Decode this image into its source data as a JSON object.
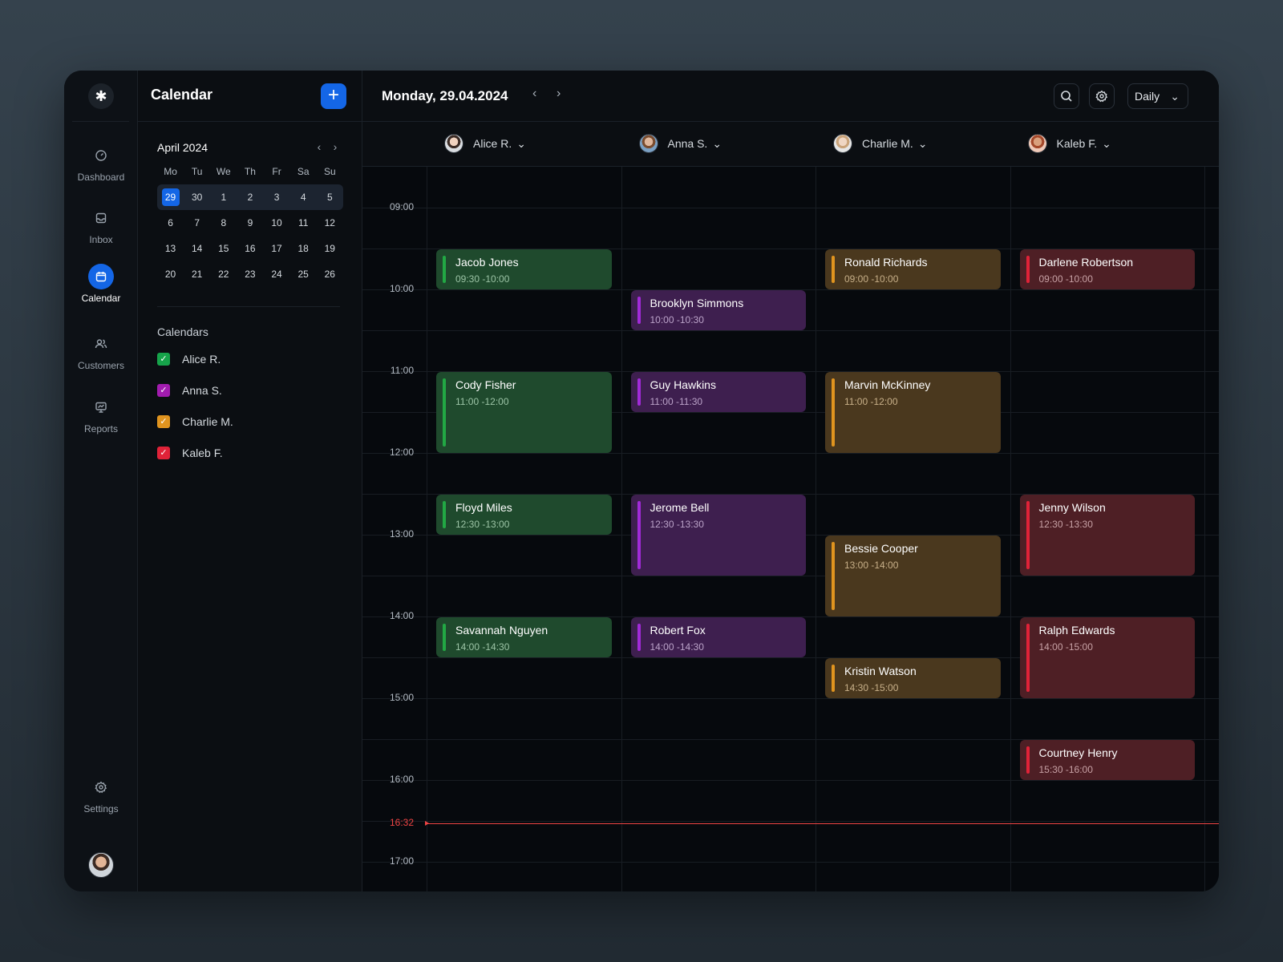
{
  "rail": {
    "items": [
      {
        "label": "Dashboard",
        "icon": "dashboard-icon"
      },
      {
        "label": "Inbox",
        "icon": "inbox-icon"
      },
      {
        "label": "Calendar",
        "icon": "calendar-icon",
        "active": true
      },
      {
        "label": "Customers",
        "icon": "customers-icon"
      },
      {
        "label": "Reports",
        "icon": "reports-icon"
      }
    ],
    "settings_label": "Settings"
  },
  "sidebar": {
    "title": "Calendar",
    "add_label": "+",
    "mini": {
      "month": "April 2024",
      "weekdays": [
        "Mo",
        "Tu",
        "We",
        "Th",
        "Fr",
        "Sa",
        "Su"
      ],
      "weeks": [
        [
          "29",
          "30",
          "1",
          "2",
          "3",
          "4",
          "5"
        ],
        [
          "6",
          "7",
          "8",
          "9",
          "10",
          "11",
          "12"
        ],
        [
          "13",
          "14",
          "15",
          "16",
          "17",
          "18",
          "19"
        ],
        [
          "20",
          "21",
          "22",
          "23",
          "24",
          "25",
          "26"
        ]
      ],
      "selected": "29"
    },
    "calendars_title": "Calendars",
    "calendars": [
      {
        "name": "Alice R.",
        "color": "#16a34a"
      },
      {
        "name": "Anna S.",
        "color": "#a21caf"
      },
      {
        "name": "Charlie M.",
        "color": "#e0941f"
      },
      {
        "name": "Kaleb F.",
        "color": "#e02238"
      }
    ]
  },
  "header": {
    "date": "Monday, 29.04.2024",
    "view": "Daily"
  },
  "people": [
    "Alice R.",
    "Anna S.",
    "Charlie M.",
    "Kaleb F."
  ],
  "times": [
    "09:00",
    "10:00",
    "11:00",
    "12:00",
    "13:00",
    "14:00",
    "15:00",
    "16:00",
    "17:00"
  ],
  "now": "16:32",
  "events": [
    {
      "col": 0,
      "name": "Jacob Jones",
      "time": "09:30 -10:00",
      "start": 9.5,
      "end": 10,
      "color": "green"
    },
    {
      "col": 0,
      "name": "Cody Fisher",
      "time": "11:00 -12:00",
      "start": 11,
      "end": 12,
      "color": "green"
    },
    {
      "col": 0,
      "name": "Floyd Miles",
      "time": "12:30 -13:00",
      "start": 12.5,
      "end": 13,
      "color": "green"
    },
    {
      "col": 0,
      "name": "Savannah Nguyen",
      "time": "14:00 -14:30",
      "start": 14,
      "end": 14.5,
      "color": "green"
    },
    {
      "col": 1,
      "name": "Brooklyn Simmons",
      "time": "10:00 -10:30",
      "start": 10,
      "end": 10.5,
      "color": "purple"
    },
    {
      "col": 1,
      "name": "Guy Hawkins",
      "time": "11:00 -11:30",
      "start": 11,
      "end": 11.5,
      "color": "purple"
    },
    {
      "col": 1,
      "name": "Jerome Bell",
      "time": "12:30 -13:30",
      "start": 12.5,
      "end": 13.5,
      "color": "purple"
    },
    {
      "col": 1,
      "name": "Robert Fox",
      "time": "14:00 -14:30",
      "start": 14,
      "end": 14.5,
      "color": "purple"
    },
    {
      "col": 2,
      "name": "Ronald Richards",
      "time": "09:00 -10:00",
      "start": 9.5,
      "end": 10,
      "color": "orange"
    },
    {
      "col": 2,
      "name": "Marvin McKinney",
      "time": "11:00 -12:00",
      "start": 11,
      "end": 12,
      "color": "orange"
    },
    {
      "col": 2,
      "name": "Bessie Cooper",
      "time": "13:00 -14:00",
      "start": 13,
      "end": 14,
      "color": "orange"
    },
    {
      "col": 2,
      "name": "Kristin Watson",
      "time": "14:30 -15:00",
      "start": 14.5,
      "end": 15,
      "color": "orange"
    },
    {
      "col": 3,
      "name": "Darlene Robertson",
      "time": "09:00 -10:00",
      "start": 9.5,
      "end": 10,
      "color": "red"
    },
    {
      "col": 3,
      "name": "Jenny Wilson",
      "time": "12:30 -13:30",
      "start": 12.5,
      "end": 13.5,
      "color": "red"
    },
    {
      "col": 3,
      "name": "Ralph Edwards",
      "time": "14:00 -15:00",
      "start": 14,
      "end": 15,
      "color": "red"
    },
    {
      "col": 3,
      "name": "Courtney Henry",
      "time": "15:30 -16:00",
      "start": 15.5,
      "end": 16,
      "color": "red"
    }
  ]
}
